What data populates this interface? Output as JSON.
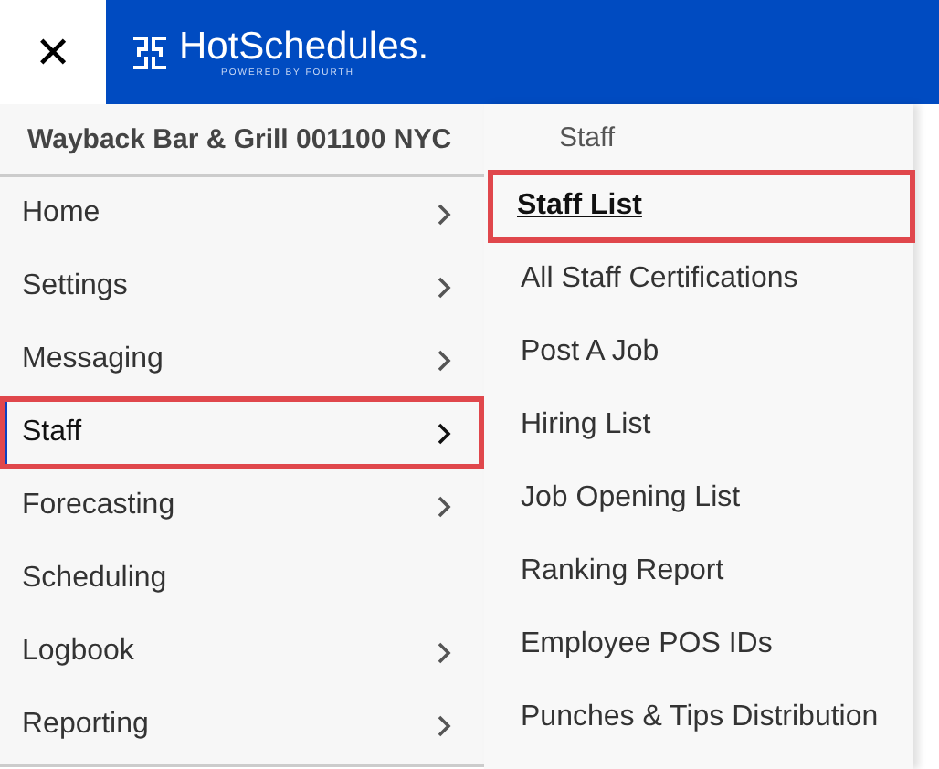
{
  "top_bar": {
    "close_label": "✕",
    "logo_text": "HotSchedules.",
    "logo_tagline": "POWERED BY FOURTH"
  },
  "location": "Wayback Bar & Grill 001100 NYC",
  "menu": [
    {
      "label": "Home",
      "has_submenu": true,
      "selected": false,
      "highlighted": false
    },
    {
      "label": "Settings",
      "has_submenu": true,
      "selected": false,
      "highlighted": false
    },
    {
      "label": "Messaging",
      "has_submenu": true,
      "selected": false,
      "highlighted": false
    },
    {
      "label": "Staff",
      "has_submenu": true,
      "selected": true,
      "highlighted": true
    },
    {
      "label": "Forecasting",
      "has_submenu": true,
      "selected": false,
      "highlighted": false
    },
    {
      "label": "Scheduling",
      "has_submenu": false,
      "selected": false,
      "highlighted": false
    },
    {
      "label": "Logbook",
      "has_submenu": true,
      "selected": false,
      "highlighted": false
    },
    {
      "label": "Reporting",
      "has_submenu": true,
      "selected": false,
      "highlighted": false
    }
  ],
  "submenu": {
    "title": "Staff",
    "items": [
      {
        "label": "Staff List",
        "selected": true,
        "highlighted": true
      },
      {
        "label": "All Staff Certifications",
        "selected": false,
        "highlighted": false
      },
      {
        "label": "Post A Job",
        "selected": false,
        "highlighted": false
      },
      {
        "label": "Hiring List",
        "selected": false,
        "highlighted": false
      },
      {
        "label": "Job Opening List",
        "selected": false,
        "highlighted": false
      },
      {
        "label": "Ranking Report",
        "selected": false,
        "highlighted": false
      },
      {
        "label": "Employee POS IDs",
        "selected": false,
        "highlighted": false
      },
      {
        "label": "Punches & Tips Distribution",
        "selected": false,
        "highlighted": false
      }
    ]
  }
}
